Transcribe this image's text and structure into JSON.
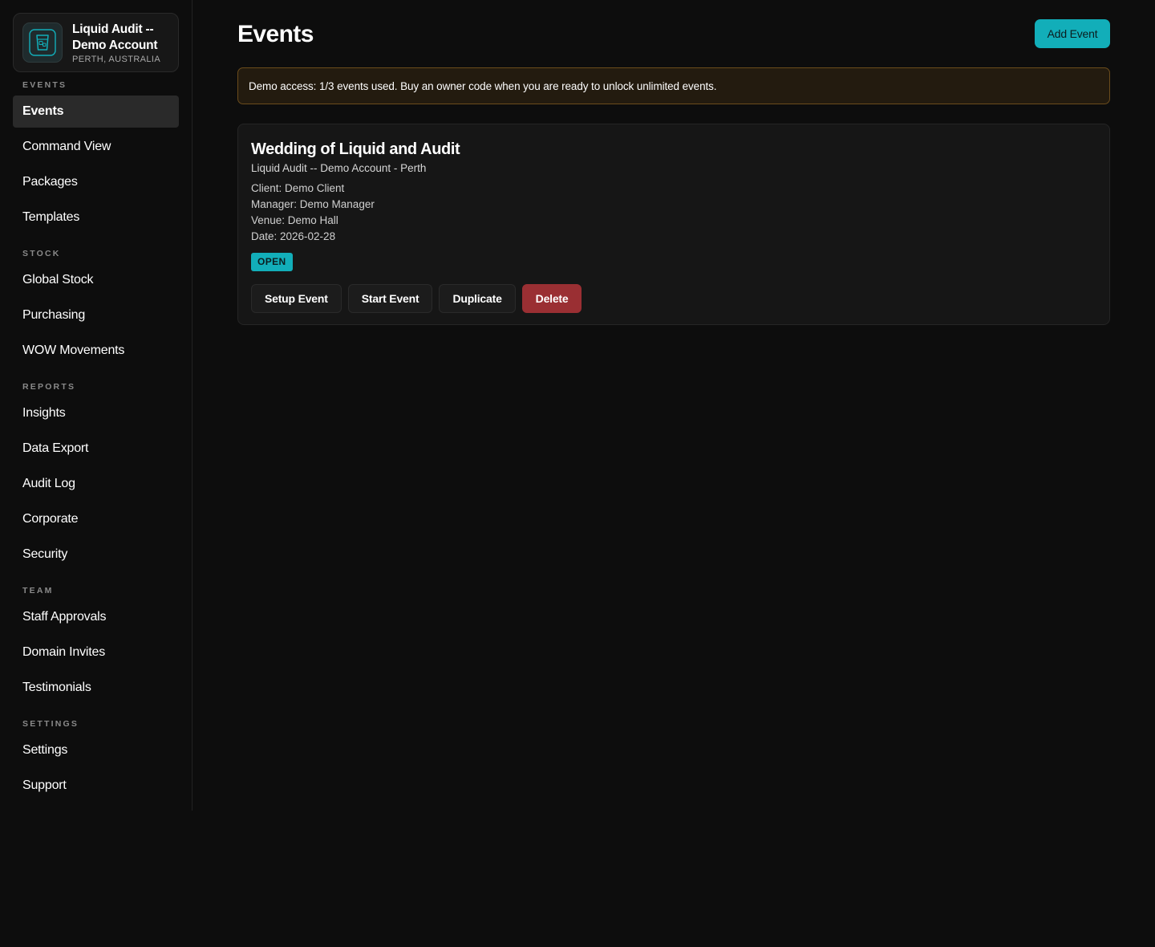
{
  "account": {
    "name": "Liquid Audit -- Demo Account",
    "location": "PERTH, AUSTRALIA",
    "logo_icon": "drink-glass-icon"
  },
  "sidebar": {
    "sections": [
      {
        "label": "EVENTS",
        "items": [
          "Events",
          "Command View",
          "Packages",
          "Templates"
        ]
      },
      {
        "label": "STOCK",
        "items": [
          "Global Stock",
          "Purchasing",
          "WOW Movements"
        ]
      },
      {
        "label": "REPORTS",
        "items": [
          "Insights",
          "Data Export",
          "Audit Log",
          "Corporate",
          "Security"
        ]
      },
      {
        "label": "TEAM",
        "items": [
          "Staff Approvals",
          "Domain Invites",
          "Testimonials"
        ]
      },
      {
        "label": "SETTINGS",
        "items": [
          "Settings",
          "Support"
        ]
      }
    ],
    "active_item": "Events"
  },
  "main": {
    "title": "Events",
    "add_button": "Add Event",
    "banner": "Demo access: 1/3 events used. Buy an owner code when you are ready to unlock unlimited events."
  },
  "event": {
    "title": "Wedding of Liquid and Audit",
    "subtitle": "Liquid Audit -- Demo Account - Perth",
    "client": "Client: Demo Client",
    "manager": "Manager: Demo Manager",
    "venue": "Venue: Demo Hall",
    "date": "Date: 2026-02-28",
    "status": "OPEN",
    "actions": {
      "setup": "Setup Event",
      "start": "Start Event",
      "duplicate": "Duplicate",
      "delete": "Delete"
    }
  },
  "colors": {
    "accent": "#12aeb9",
    "danger": "#9a2f33",
    "banner_bg": "#231b0f",
    "banner_border": "#6b4c1c",
    "background": "#0d0d0d"
  }
}
